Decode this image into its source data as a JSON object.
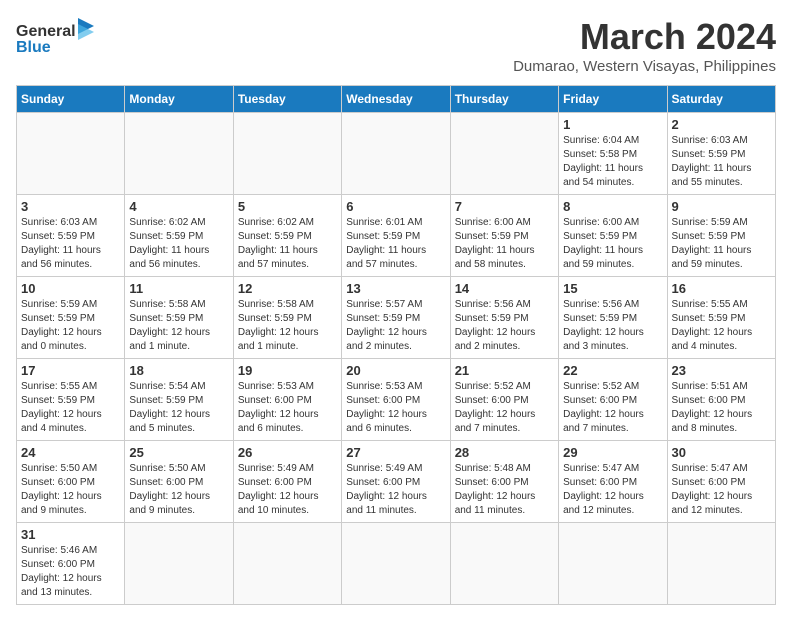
{
  "header": {
    "logo_general": "General",
    "logo_blue": "Blue",
    "month_title": "March 2024",
    "location": "Dumarao, Western Visayas, Philippines"
  },
  "weekdays": [
    "Sunday",
    "Monday",
    "Tuesday",
    "Wednesday",
    "Thursday",
    "Friday",
    "Saturday"
  ],
  "weeks": [
    [
      {
        "day": "",
        "info": ""
      },
      {
        "day": "",
        "info": ""
      },
      {
        "day": "",
        "info": ""
      },
      {
        "day": "",
        "info": ""
      },
      {
        "day": "",
        "info": ""
      },
      {
        "day": "1",
        "info": "Sunrise: 6:04 AM\nSunset: 5:58 PM\nDaylight: 11 hours\nand 54 minutes."
      },
      {
        "day": "2",
        "info": "Sunrise: 6:03 AM\nSunset: 5:59 PM\nDaylight: 11 hours\nand 55 minutes."
      }
    ],
    [
      {
        "day": "3",
        "info": "Sunrise: 6:03 AM\nSunset: 5:59 PM\nDaylight: 11 hours\nand 56 minutes."
      },
      {
        "day": "4",
        "info": "Sunrise: 6:02 AM\nSunset: 5:59 PM\nDaylight: 11 hours\nand 56 minutes."
      },
      {
        "day": "5",
        "info": "Sunrise: 6:02 AM\nSunset: 5:59 PM\nDaylight: 11 hours\nand 57 minutes."
      },
      {
        "day": "6",
        "info": "Sunrise: 6:01 AM\nSunset: 5:59 PM\nDaylight: 11 hours\nand 57 minutes."
      },
      {
        "day": "7",
        "info": "Sunrise: 6:00 AM\nSunset: 5:59 PM\nDaylight: 11 hours\nand 58 minutes."
      },
      {
        "day": "8",
        "info": "Sunrise: 6:00 AM\nSunset: 5:59 PM\nDaylight: 11 hours\nand 59 minutes."
      },
      {
        "day": "9",
        "info": "Sunrise: 5:59 AM\nSunset: 5:59 PM\nDaylight: 11 hours\nand 59 minutes."
      }
    ],
    [
      {
        "day": "10",
        "info": "Sunrise: 5:59 AM\nSunset: 5:59 PM\nDaylight: 12 hours\nand 0 minutes."
      },
      {
        "day": "11",
        "info": "Sunrise: 5:58 AM\nSunset: 5:59 PM\nDaylight: 12 hours\nand 1 minute."
      },
      {
        "day": "12",
        "info": "Sunrise: 5:58 AM\nSunset: 5:59 PM\nDaylight: 12 hours\nand 1 minute."
      },
      {
        "day": "13",
        "info": "Sunrise: 5:57 AM\nSunset: 5:59 PM\nDaylight: 12 hours\nand 2 minutes."
      },
      {
        "day": "14",
        "info": "Sunrise: 5:56 AM\nSunset: 5:59 PM\nDaylight: 12 hours\nand 2 minutes."
      },
      {
        "day": "15",
        "info": "Sunrise: 5:56 AM\nSunset: 5:59 PM\nDaylight: 12 hours\nand 3 minutes."
      },
      {
        "day": "16",
        "info": "Sunrise: 5:55 AM\nSunset: 5:59 PM\nDaylight: 12 hours\nand 4 minutes."
      }
    ],
    [
      {
        "day": "17",
        "info": "Sunrise: 5:55 AM\nSunset: 5:59 PM\nDaylight: 12 hours\nand 4 minutes."
      },
      {
        "day": "18",
        "info": "Sunrise: 5:54 AM\nSunset: 5:59 PM\nDaylight: 12 hours\nand 5 minutes."
      },
      {
        "day": "19",
        "info": "Sunrise: 5:53 AM\nSunset: 6:00 PM\nDaylight: 12 hours\nand 6 minutes."
      },
      {
        "day": "20",
        "info": "Sunrise: 5:53 AM\nSunset: 6:00 PM\nDaylight: 12 hours\nand 6 minutes."
      },
      {
        "day": "21",
        "info": "Sunrise: 5:52 AM\nSunset: 6:00 PM\nDaylight: 12 hours\nand 7 minutes."
      },
      {
        "day": "22",
        "info": "Sunrise: 5:52 AM\nSunset: 6:00 PM\nDaylight: 12 hours\nand 7 minutes."
      },
      {
        "day": "23",
        "info": "Sunrise: 5:51 AM\nSunset: 6:00 PM\nDaylight: 12 hours\nand 8 minutes."
      }
    ],
    [
      {
        "day": "24",
        "info": "Sunrise: 5:50 AM\nSunset: 6:00 PM\nDaylight: 12 hours\nand 9 minutes."
      },
      {
        "day": "25",
        "info": "Sunrise: 5:50 AM\nSunset: 6:00 PM\nDaylight: 12 hours\nand 9 minutes."
      },
      {
        "day": "26",
        "info": "Sunrise: 5:49 AM\nSunset: 6:00 PM\nDaylight: 12 hours\nand 10 minutes."
      },
      {
        "day": "27",
        "info": "Sunrise: 5:49 AM\nSunset: 6:00 PM\nDaylight: 12 hours\nand 11 minutes."
      },
      {
        "day": "28",
        "info": "Sunrise: 5:48 AM\nSunset: 6:00 PM\nDaylight: 12 hours\nand 11 minutes."
      },
      {
        "day": "29",
        "info": "Sunrise: 5:47 AM\nSunset: 6:00 PM\nDaylight: 12 hours\nand 12 minutes."
      },
      {
        "day": "30",
        "info": "Sunrise: 5:47 AM\nSunset: 6:00 PM\nDaylight: 12 hours\nand 12 minutes."
      }
    ],
    [
      {
        "day": "31",
        "info": "Sunrise: 5:46 AM\nSunset: 6:00 PM\nDaylight: 12 hours\nand 13 minutes."
      },
      {
        "day": "",
        "info": ""
      },
      {
        "day": "",
        "info": ""
      },
      {
        "day": "",
        "info": ""
      },
      {
        "day": "",
        "info": ""
      },
      {
        "day": "",
        "info": ""
      },
      {
        "day": "",
        "info": ""
      }
    ]
  ]
}
